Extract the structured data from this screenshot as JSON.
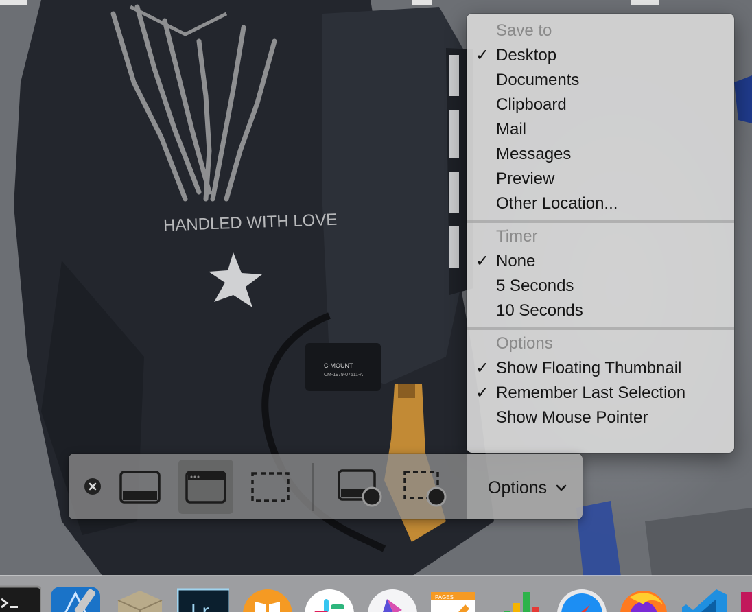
{
  "menu": {
    "sections": [
      {
        "header": "Save to",
        "items": [
          {
            "label": "Desktop",
            "checked": true
          },
          {
            "label": "Documents",
            "checked": false
          },
          {
            "label": "Clipboard",
            "checked": false
          },
          {
            "label": "Mail",
            "checked": false
          },
          {
            "label": "Messages",
            "checked": false
          },
          {
            "label": "Preview",
            "checked": false
          },
          {
            "label": "Other Location...",
            "checked": false
          }
        ]
      },
      {
        "header": "Timer",
        "items": [
          {
            "label": "None",
            "checked": true
          },
          {
            "label": "5 Seconds",
            "checked": false
          },
          {
            "label": "10 Seconds",
            "checked": false
          }
        ]
      },
      {
        "header": "Options",
        "items": [
          {
            "label": "Show Floating Thumbnail",
            "checked": true
          },
          {
            "label": "Remember Last Selection",
            "checked": true
          },
          {
            "label": "Show Mouse Pointer",
            "checked": false
          }
        ]
      }
    ],
    "check_glyph": "✓"
  },
  "toolbar": {
    "options_label": "Options",
    "tools": [
      {
        "icon": "capture-entire-screen-icon",
        "selected": false
      },
      {
        "icon": "capture-selected-window-icon",
        "selected": true
      },
      {
        "icon": "capture-selected-portion-icon",
        "selected": false
      },
      {
        "icon": "record-entire-screen-icon",
        "selected": false
      },
      {
        "icon": "record-selected-portion-icon",
        "selected": false
      }
    ]
  },
  "wallpaper": {
    "visible_text": [
      "HANDLED WITH LOVE",
      "C-MOUNT",
      "CM-1979-07511-A"
    ]
  },
  "dock": {
    "apps": [
      "terminal-icon",
      "xcode-icon",
      "archive-utility-icon",
      "lightroom-icon",
      "books-icon",
      "slack-icon",
      "affinity-designer-icon",
      "pages-icon",
      "numbers-icon",
      "safari-icon",
      "firefox-icon",
      "visual-studio-code-icon"
    ]
  },
  "colors": {
    "menu_background": "#d6d6d6",
    "menu_header_text": "#8a8a8a",
    "menu_item_text": "#151515",
    "toolbar_background": "#8c8c8c",
    "selected_tool_background": "#5a5a5a"
  }
}
